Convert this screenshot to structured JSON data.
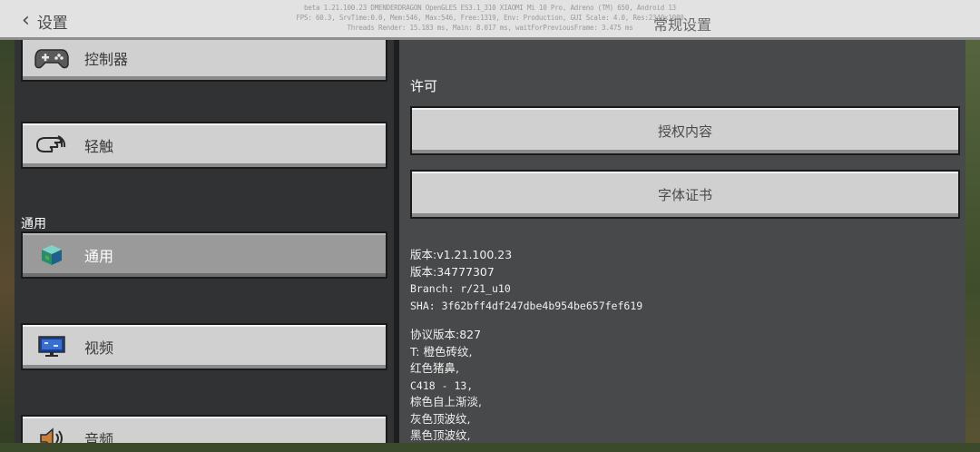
{
  "header": {
    "back_label": "设置",
    "title": "常规设置",
    "debug_lines": [
      "beta 1.21.100.23 DMENDERDRAGON OpenGLES ES3.1_310 XIAOMI Mi 10 Pro, Adreno (TM) 650, Android 13",
      "FPS: 60.3, SrvTime:0.0, Mem:546, Max:546, Free:1319, Env: Production, GUI Scale: 4.0, Res:2340x1080",
      "Threads Render: 15.183 ms, Main: 8.017 ms, waitForPreviousFrame: 3.475 ms"
    ]
  },
  "sidebar": {
    "items": [
      {
        "label": "控制器",
        "icon": "gamepad-icon"
      },
      {
        "label": "轻触",
        "icon": "touch-hand-icon"
      },
      {
        "label": "通用",
        "icon": "cube-icon",
        "selected": true
      },
      {
        "label": "视频",
        "icon": "monitor-icon"
      },
      {
        "label": "音频",
        "icon": "speaker-icon"
      }
    ],
    "section_general": "通用"
  },
  "main": {
    "heading": "许可",
    "buttons": {
      "licensed_content": "授权内容",
      "font_license": "字体证书"
    },
    "version_block": [
      "版本:v1.21.100.23",
      "版本:34777307",
      "Branch: r/21_u10",
      "SHA: 3f62bff4df247dbe4b954be657fef619"
    ],
    "protocol_block": [
      "协议版本:827",
      "T: 橙色砖纹,",
      "红色猪鼻,",
      "C418 - 13,",
      "棕色自上渐淡,",
      "灰色顶波纹,",
      "黑色顶波纹,"
    ]
  },
  "colors": {
    "header_bg": "#e2e2e2",
    "button_bg": "#d0d0d0",
    "button_selected_bg": "#9a9a9a",
    "left_panel_bg": "#313233",
    "right_panel_bg": "#48494a"
  }
}
